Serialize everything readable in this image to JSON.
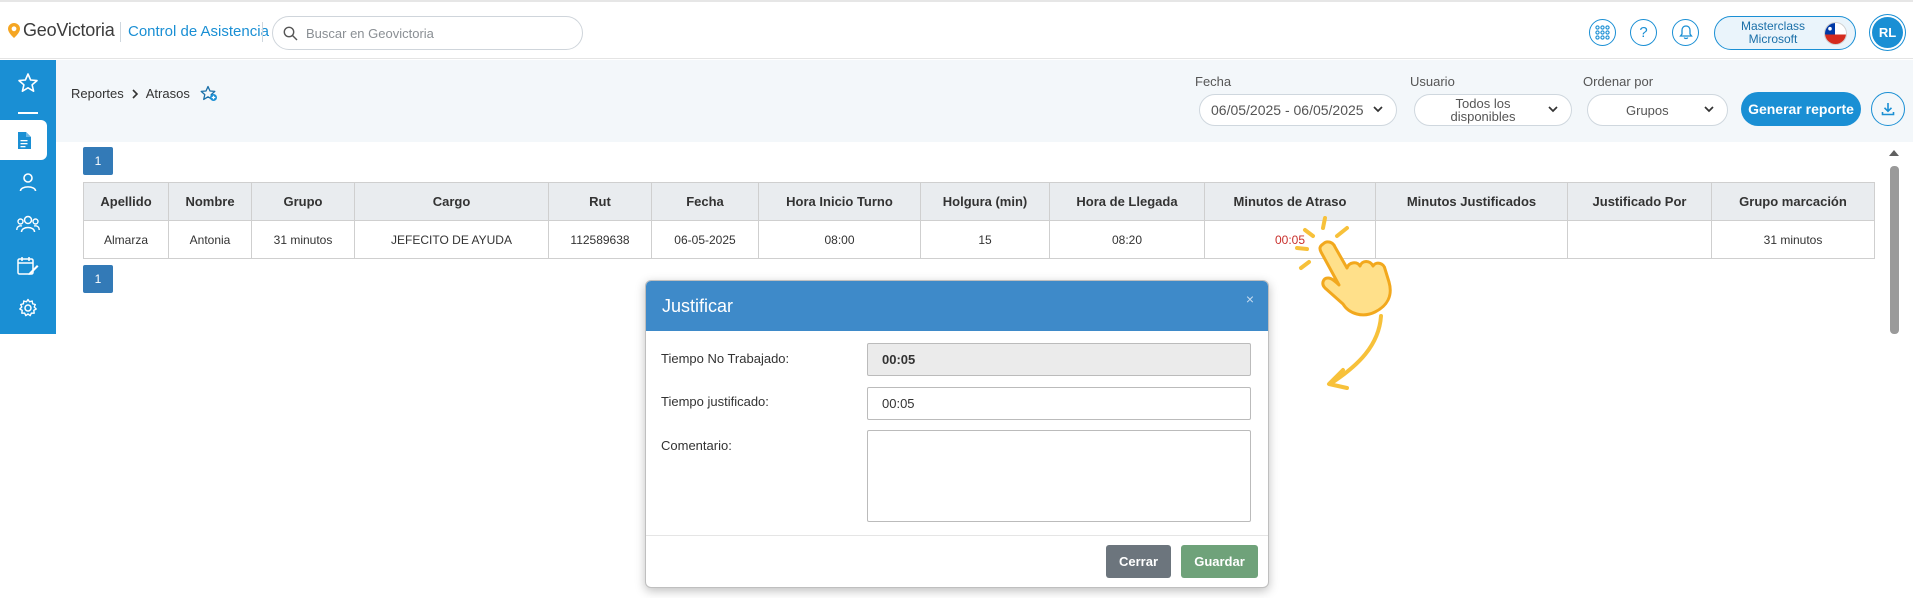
{
  "header": {
    "logo_text": "GeoVictoria",
    "module_name": "Control de Asistencia",
    "search_placeholder": "Buscar en Geovictoria",
    "company_name": "Masterclass Microsoft",
    "avatar_initials": "RL",
    "icons": [
      "apps-grid-icon",
      "help-icon",
      "bell-icon"
    ]
  },
  "sidebar": {
    "items": [
      "star-icon",
      "report-document-icon",
      "user-icon",
      "group-users-icon",
      "schedule-edit-icon",
      "gear-icon"
    ],
    "active": "report-document-icon"
  },
  "breadcrumb": {
    "parent": "Reportes",
    "current": "Atrasos"
  },
  "filters": {
    "fecha_label": "Fecha",
    "fecha_value": "06/05/2025 - 06/05/2025",
    "usuario_label": "Usuario",
    "usuario_value": "Todos los disponibles",
    "ordenar_label": "Ordenar por",
    "ordenar_value": "Grupos",
    "generate_label": "Generar reporte"
  },
  "pagination": {
    "page": "1"
  },
  "table": {
    "columns": [
      "Apellido",
      "Nombre",
      "Grupo",
      "Cargo",
      "Rut",
      "Fecha",
      "Hora Inicio Turno",
      "Holgura (min)",
      "Hora de Llegada",
      "Minutos de Atraso",
      "Minutos Justificados",
      "Justificado Por",
      "Grupo marcación"
    ],
    "rows": [
      [
        "Almarza",
        "Antonia",
        "31 minutos",
        "JEFECITO DE AYUDA",
        "112589638",
        "06-05-2025",
        "08:00",
        "15",
        "08:20",
        "00:05",
        "",
        "",
        "31 minutos"
      ]
    ]
  },
  "modal": {
    "title": "Justificar",
    "close_symbol": "×",
    "tiempo_no_trabajado_label": "Tiempo No Trabajado:",
    "tiempo_no_trabajado_value": "00:05",
    "tiempo_justificado_label": "Tiempo justificado:",
    "tiempo_justificado_value": "00:05",
    "comentario_label": "Comentario:",
    "comentario_value": "",
    "cerrar_label": "Cerrar",
    "guardar_label": "Guardar"
  },
  "colors": {
    "brand_blue": "#1a8fd4",
    "modal_header": "#3e8ac9",
    "late_red": "#c9302c",
    "guardar_green": "#6fa27a",
    "cerrar_gray": "#6c757d",
    "annotation_yellow": "#f7c13a"
  }
}
